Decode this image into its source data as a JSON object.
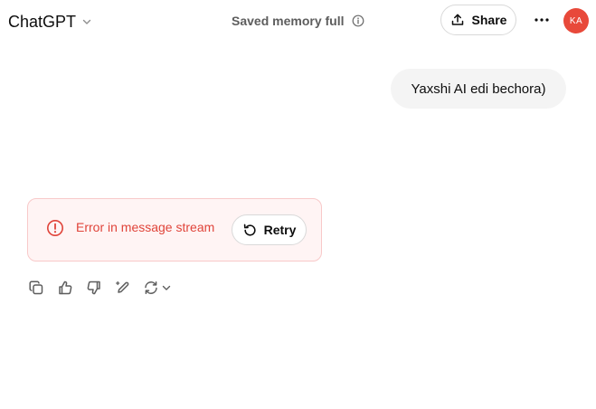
{
  "header": {
    "model_name": "ChatGPT",
    "memory_status": "Saved memory full",
    "share_label": "Share",
    "avatar_initials": "KA",
    "avatar_color": "#e8493a"
  },
  "conversation": {
    "user_message": "Yaxshi AI edi bechora)",
    "error_message": "Error in message stream",
    "retry_label": "Retry"
  },
  "icons": {
    "model_chevron": "chevron-down-icon",
    "memory_info": "info-icon",
    "share": "upload-icon",
    "more": "more-horizontal-icon",
    "error": "alert-circle-icon",
    "retry": "rotate-ccw-icon",
    "copy": "copy-icon",
    "thumbs_up": "thumbs-up-icon",
    "thumbs_down": "thumbs-down-icon",
    "edit_canvas": "edit-pencil-icon",
    "regenerate": "refresh-icon",
    "regenerate_menu": "chevron-down-icon"
  },
  "colors": {
    "error_text": "#e0443a",
    "error_bg": "#fff4f4",
    "error_border": "#f8c9c9",
    "bubble_bg": "#f4f4f4"
  }
}
